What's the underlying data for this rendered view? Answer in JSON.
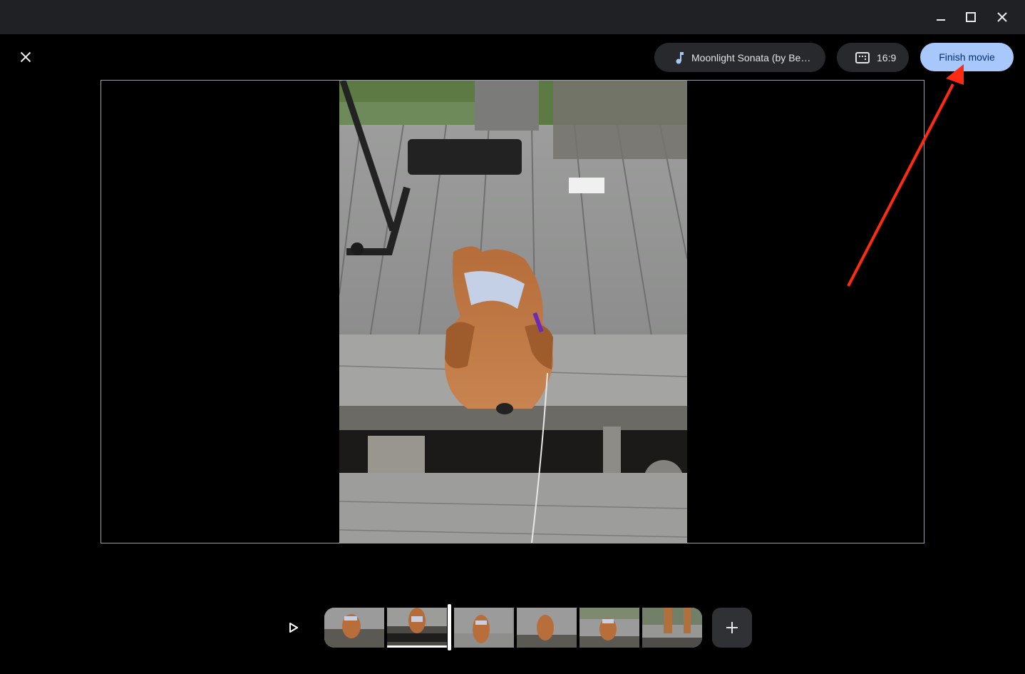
{
  "window": {
    "controls": [
      "minimize",
      "maximize",
      "close"
    ]
  },
  "editor": {
    "close_icon": "close-icon",
    "music": {
      "icon": "music-note-icon",
      "label": "Moonlight Sonata (by Be…"
    },
    "aspect_ratio": {
      "icon": "aspect-ratio-icon",
      "label": "16:9"
    },
    "finish_label": "Finish movie",
    "colors": {
      "accent": "#a8c7fa",
      "accent_text": "#062e6f",
      "pill_bg": "#28292c",
      "titlebar_bg": "#202124",
      "annotation_arrow": "#ff2a12"
    }
  },
  "preview": {
    "subject": "Puppy with harness lying on wooden deck step"
  },
  "timeline": {
    "play_icon": "play-icon",
    "add_icon": "plus-icon",
    "clips": [
      {
        "name": "clip-1",
        "desc": "puppy lying on step"
      },
      {
        "name": "clip-2",
        "desc": "puppy sitting on deck",
        "selected": true
      },
      {
        "name": "clip-3",
        "desc": "puppy lying on step close-up"
      },
      {
        "name": "clip-4",
        "desc": "puppy looking down"
      },
      {
        "name": "clip-5",
        "desc": "puppy lying on step"
      },
      {
        "name": "clip-6",
        "desc": "puppy legs walking"
      }
    ],
    "playhead_after_clip": 2
  }
}
